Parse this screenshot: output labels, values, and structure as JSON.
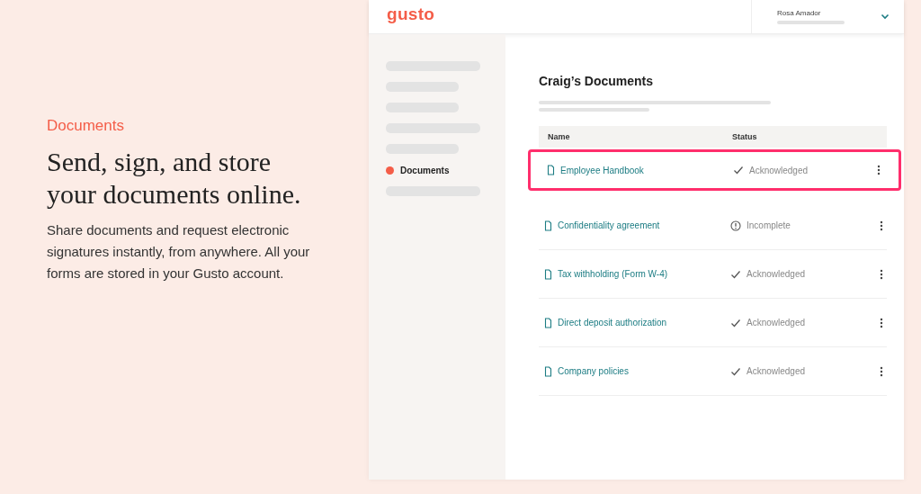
{
  "intro": {
    "eyebrow": "Documents",
    "headline": "Send, sign, and store your documents online.",
    "body": "Share documents and request electronic signatures instantly, from anywhere. All your forms are stored in your Gusto account."
  },
  "app": {
    "logo": "gusto",
    "user": {
      "name": "Rosa Amador"
    },
    "sidebar": {
      "items": [
        {
          "kind": "skeleton_long"
        },
        {
          "kind": "skeleton_short"
        },
        {
          "kind": "skeleton_short"
        },
        {
          "kind": "skeleton_long"
        },
        {
          "kind": "skeleton_short"
        },
        {
          "kind": "link",
          "label": "Documents",
          "selected": true
        },
        {
          "kind": "skeleton_long"
        }
      ]
    },
    "page_title": "Craig’s Documents",
    "table": {
      "columns": [
        "Name",
        "Status"
      ],
      "rows": [
        {
          "kind": "done",
          "name": "Employee Handbook",
          "status": "Acknowledged",
          "highlighted": true
        },
        {
          "kind": "incomplete",
          "name": "Confidentiality agreement",
          "status": "Incomplete",
          "highlighted": false
        },
        {
          "kind": "done",
          "name": "Tax withholding (Form W-4)",
          "status": "Acknowledged",
          "highlighted": false
        },
        {
          "kind": "done",
          "name": "Direct deposit authorization",
          "status": "Acknowledged",
          "highlighted": false
        },
        {
          "kind": "done",
          "name": "Company policies",
          "status": "Acknowledged",
          "highlighted": false
        }
      ]
    }
  }
}
